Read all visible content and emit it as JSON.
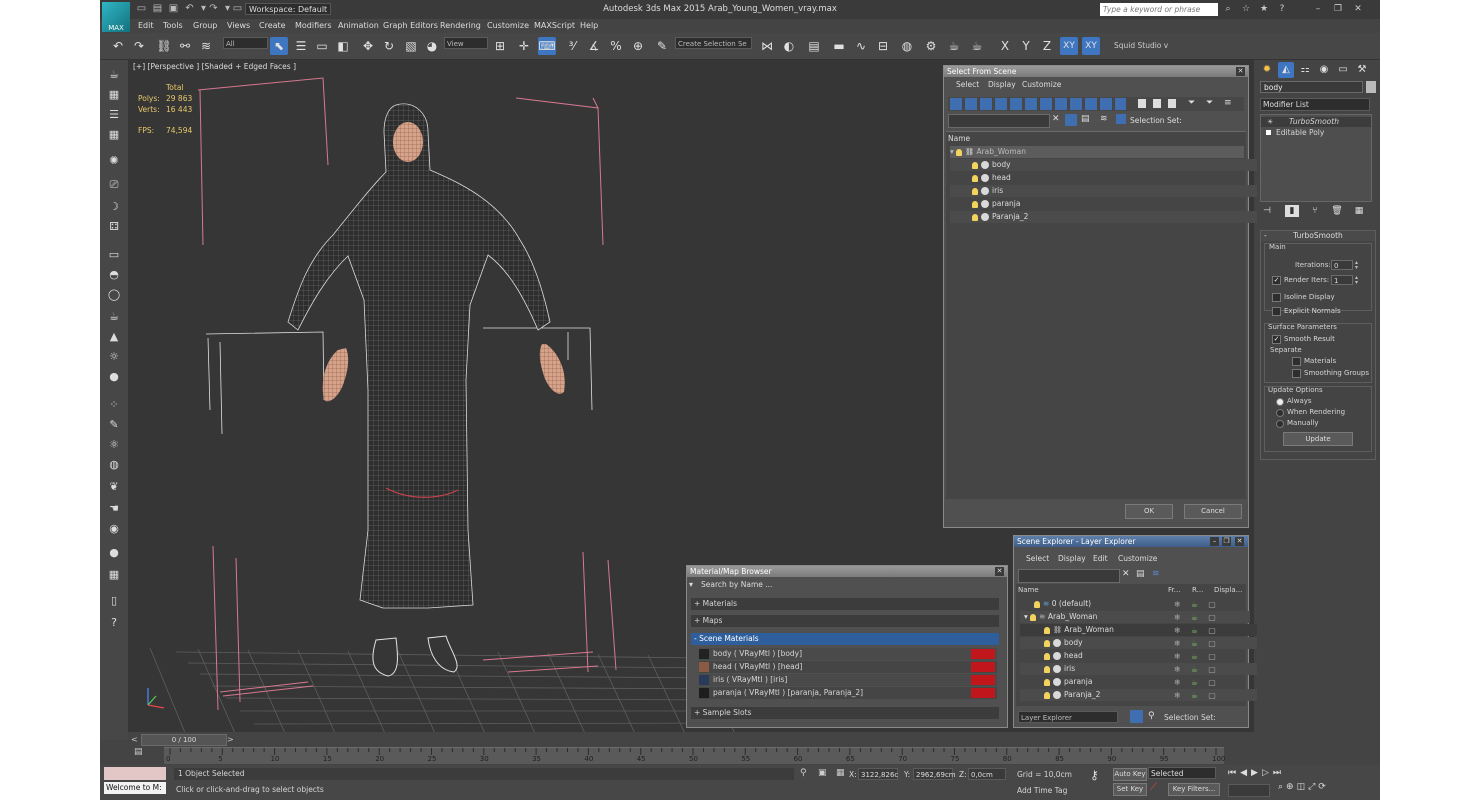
{
  "app": {
    "title": "Autodesk 3ds Max  2015     Arab_Young_Women_vray.max",
    "logo_text": "MAX",
    "workspace": "Workspace: Default",
    "keyword_placeholder": "Type a keyword or phrase"
  },
  "menu": [
    "Edit",
    "Tools",
    "Group",
    "Views",
    "Create",
    "Modifiers",
    "Animation",
    "Graph Editors",
    "Rendering",
    "Customize",
    "MAXScript",
    "Help"
  ],
  "toolbar": {
    "selection_filter": "All",
    "ref_coord": "View",
    "named_selection": "Create Selection Se",
    "axis_labels": [
      "X",
      "Y",
      "Z",
      "XY",
      "XY"
    ],
    "squid": "Squid Studio v"
  },
  "viewport": {
    "label": "[+] [Perspective ] [Shaded + Edged Faces ]",
    "stats": {
      "total_label": "Total",
      "polys_label": "Polys:",
      "polys": "29 863",
      "verts_label": "Verts:",
      "verts": "16 443",
      "fps_label": "FPS:",
      "fps": "74,594"
    }
  },
  "select_from_scene": {
    "title": "Select From Scene",
    "menu": [
      "Select",
      "Display",
      "Customize"
    ],
    "selection_set_label": "Selection Set:",
    "column": "Name",
    "root": "Arab_Woman",
    "items": [
      "body",
      "head",
      "iris",
      "paranja",
      "Paranja_2"
    ],
    "ok": "OK",
    "cancel": "Cancel"
  },
  "material_browser": {
    "title": "Material/Map Browser",
    "search_placeholder": "Search by Name ...",
    "sections": {
      "materials": "+ Materials",
      "maps": "+ Maps",
      "scene": "- Scene Materials",
      "slots": "+ Sample Slots"
    },
    "scene_materials": [
      "body  ( VRayMtl ) [body]",
      "head  ( VRayMtl ) [head]",
      "iris  ( VRayMtl ) [iris]",
      "paranja  ( VRayMtl ) [paranja, Paranja_2]"
    ]
  },
  "scene_explorer": {
    "title": "Scene Explorer - Layer Explorer",
    "menu": [
      "Select",
      "Display",
      "Edit",
      "Customize"
    ],
    "columns": [
      "Name",
      "Fr...",
      "R...",
      "Displa..."
    ],
    "rows": [
      {
        "label": "0 (default)",
        "indent": 1
      },
      {
        "label": "Arab_Woman",
        "indent": 1
      },
      {
        "label": "Arab_Woman",
        "indent": 2
      },
      {
        "label": "body",
        "indent": 2
      },
      {
        "label": "head",
        "indent": 2
      },
      {
        "label": "iris",
        "indent": 2
      },
      {
        "label": "paranja",
        "indent": 2
      },
      {
        "label": "Paranja_2",
        "indent": 2
      }
    ],
    "footer_mode": "Layer Explorer",
    "footer_selset": "Selection Set:"
  },
  "command_panel": {
    "object_name": "body",
    "modifier_list": "Modifier List",
    "stack": [
      "TurboSmooth",
      "Editable Poly"
    ],
    "turbosmooth": {
      "title": "TurboSmooth",
      "main": "Main",
      "iterations_label": "Iterations:",
      "iterations": "0",
      "render_iters_label": "Render Iters:",
      "render_iters": "1",
      "isoline": "Isoline Display",
      "explicit": "Explicit Normals",
      "surface_params": "Surface Parameters",
      "smooth_result": "Smooth Result",
      "separate": "Separate",
      "materials": "Materials",
      "smoothing_groups": "Smoothing Groups",
      "update_options": "Update Options",
      "always": "Always",
      "when_rendering": "When Rendering",
      "manually": "Manually",
      "update_btn": "Update"
    }
  },
  "timeline": {
    "frame": "0 / 100",
    "ticks": [
      "0",
      "5",
      "10",
      "15",
      "20",
      "25",
      "30",
      "35",
      "40",
      "45",
      "50",
      "55",
      "60",
      "65",
      "70",
      "75",
      "80",
      "85",
      "90",
      "95",
      "100"
    ]
  },
  "status": {
    "welcome": "Welcome to M:",
    "selected": "1 Object Selected",
    "hint": "Click or click-and-drag to select objects",
    "x_label": "X:",
    "x": "3122,826c",
    "y_label": "Y:",
    "y": "2962,69cm",
    "z_label": "Z:",
    "z": "0,0cm",
    "grid": "Grid = 10,0cm",
    "add_time_tag": "Add Time Tag",
    "auto_key": "Auto Key",
    "set_key": "Set Key",
    "selected_dd": "Selected",
    "key_filters": "Key Filters..."
  },
  "colors": {
    "accent": "#3e76c2",
    "stats": "#e8c96a",
    "wire": "#d8d8d8",
    "bbox": "#d87890"
  }
}
